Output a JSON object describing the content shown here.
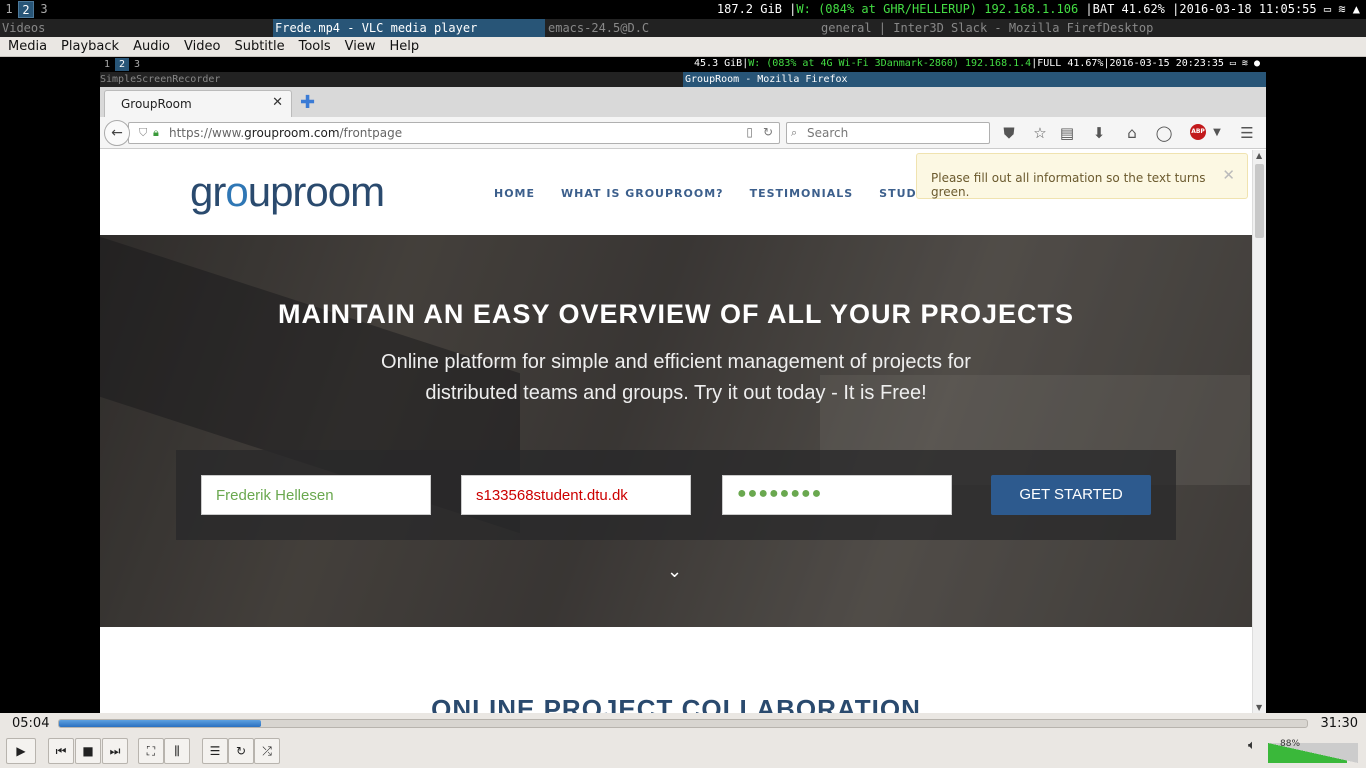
{
  "topbar": {
    "workspaces": [
      "1",
      "2",
      "3"
    ],
    "status_disk": "187.2 GiB",
    "status_wifi": "W: (084% at GHR/HELLERUP) 192.168.1.106",
    "status_bat": "BAT 41.62%",
    "status_time": "2016-03-18 11:05:55"
  },
  "titles": {
    "videos": "Videos",
    "vlc": "Frede.mp4 - VLC media player",
    "emacs": "emacs-24.5@D.C",
    "slack": "general | Inter3D Slack - Mozilla FirefDesktop"
  },
  "menu": [
    "Media",
    "Playback",
    "Audio",
    "Video",
    "Subtitle",
    "Tools",
    "View",
    "Help"
  ],
  "inner": {
    "workspaces": [
      "1",
      "2",
      "3"
    ],
    "status_disk": "45.3 GiB",
    "status_wifi": "W: (083% at 4G Wi-Fi 3Danmark-2860) 192.168.1.4",
    "status_bat": "FULL 41.67%",
    "status_time": "2016-03-15 20:23:35",
    "title_left": "SimpleScreenRecorder",
    "title_focused": "GroupRoom - Mozilla Firefox"
  },
  "browser": {
    "tab_title": "GroupRoom",
    "url_prefix": "https://www.",
    "url_domain": "grouproom.com",
    "url_path": "/frontpage",
    "search_placeholder": "Search"
  },
  "site": {
    "logo_pre": "gr",
    "logo_o": "o",
    "logo_post": "uproom",
    "nav": [
      "HOME",
      "WHAT IS GROUPROOM?",
      "TESTIMONIALS",
      "STUDENTS."
    ],
    "toast": "Please fill out all information so the text turns green.",
    "hero_title": "MAINTAIN AN EASY OVERVIEW OF ALL YOUR PROJECTS",
    "hero_sub": "Online platform for simple and efficient management of projects for distributed teams and groups. Try it out today - It is Free!",
    "name_value": "Frederik Hellesen",
    "email_value": "s133568student.dtu.dk",
    "password_mask": "●●●●●●●●",
    "cta": "GET STARTED",
    "section_title": "ONLINE PROJECT COLLABORATION"
  },
  "player": {
    "current_time": "05:04",
    "total_time": "31:30",
    "progress": 0.162,
    "volume_label": "88%",
    "volume": 0.88
  },
  "colors": {
    "accent": "#2d5a8e",
    "valid": "#6aa84f",
    "invalid": "#cc0000"
  }
}
